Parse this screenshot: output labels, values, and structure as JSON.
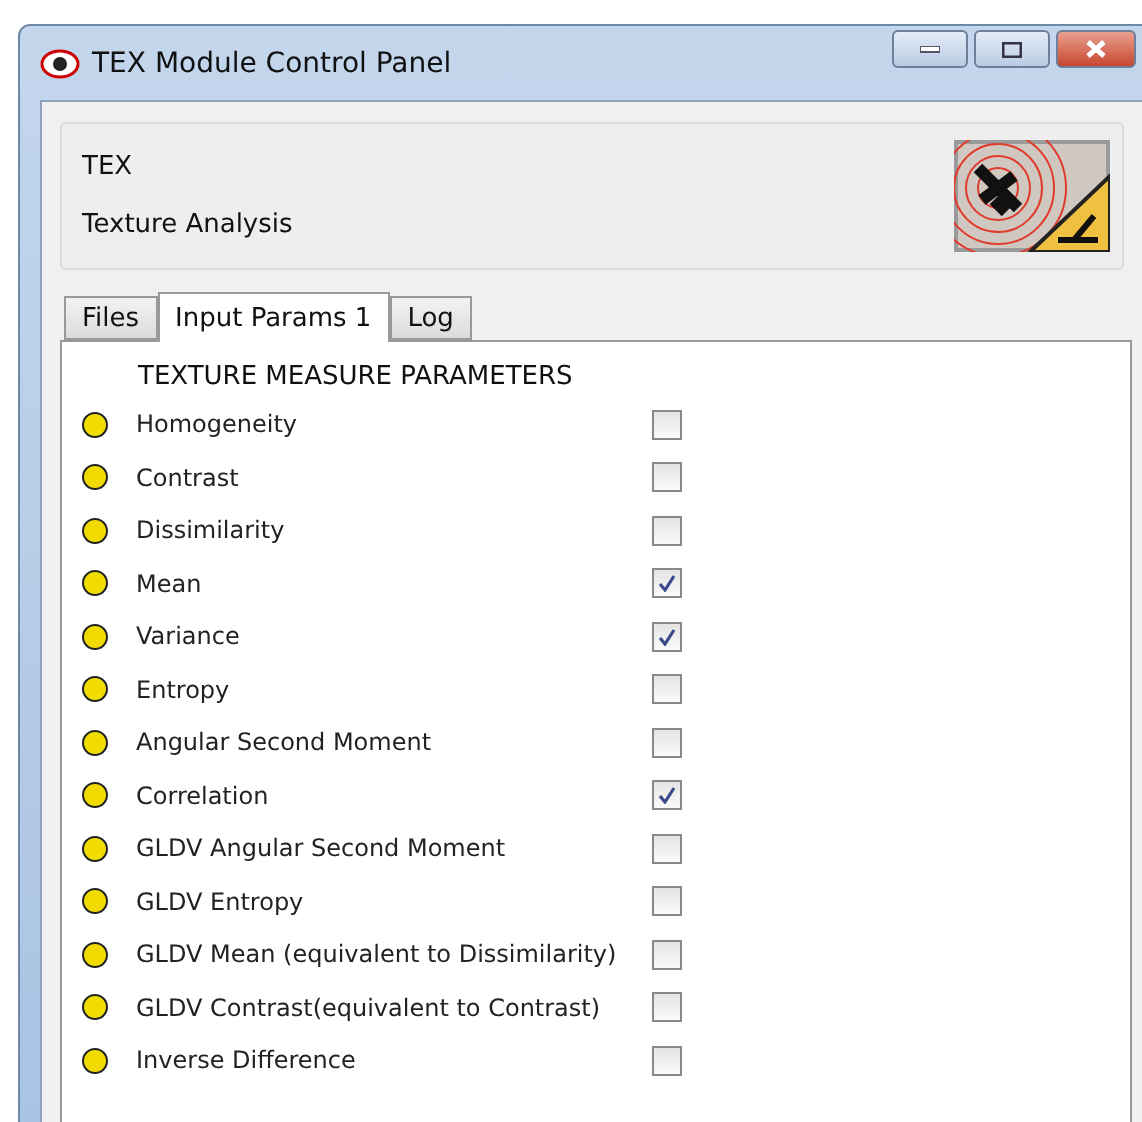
{
  "window": {
    "title": "TEX Module Control Panel"
  },
  "header": {
    "name": "TEX",
    "description": "Texture Analysis"
  },
  "tabs": [
    {
      "label": "Files",
      "selected": false
    },
    {
      "label": "Input Params 1",
      "selected": true
    },
    {
      "label": "Log",
      "selected": false
    }
  ],
  "section_title": "TEXTURE MEASURE PARAMETERS",
  "parameters": [
    {
      "label": "Homogeneity",
      "checked": false
    },
    {
      "label": "Contrast",
      "checked": false
    },
    {
      "label": "Dissimilarity",
      "checked": false
    },
    {
      "label": "Mean",
      "checked": true
    },
    {
      "label": "Variance",
      "checked": true
    },
    {
      "label": "Entropy",
      "checked": false
    },
    {
      "label": "Angular Second Moment",
      "checked": false
    },
    {
      "label": "Correlation",
      "checked": true
    },
    {
      "label": "GLDV Angular Second Moment",
      "checked": false
    },
    {
      "label": "GLDV Entropy",
      "checked": false
    },
    {
      "label": "GLDV Mean (equivalent to Dissimilarity)",
      "checked": false
    },
    {
      "label": "GLDV Contrast(equivalent to Contrast)",
      "checked": false
    },
    {
      "label": "Inverse Difference",
      "checked": false
    }
  ]
}
